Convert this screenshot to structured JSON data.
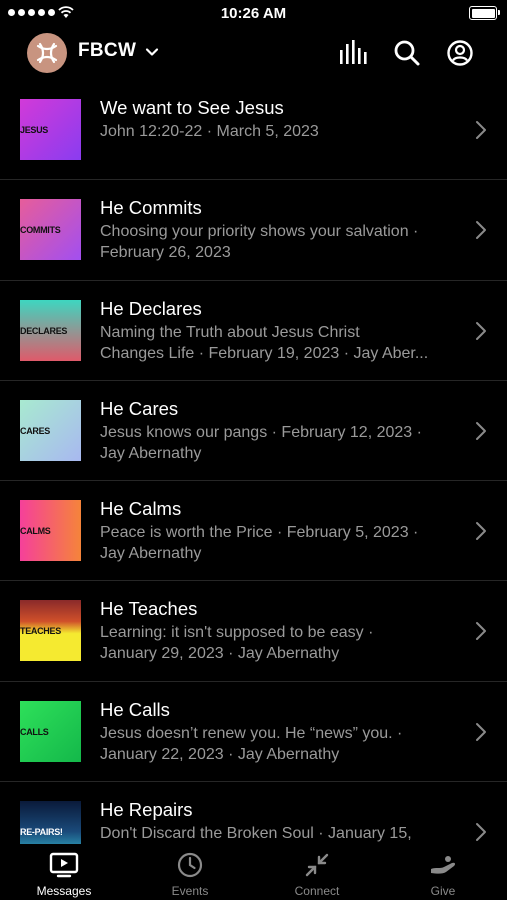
{
  "status_bar": {
    "time": "10:26 AM"
  },
  "header": {
    "church_name": "FBCW",
    "icons": [
      "church-logo",
      "chevron-down-icon",
      "audio-bars-icon",
      "search-icon",
      "account-icon"
    ]
  },
  "messages": [
    {
      "title": "We want to See Jesus",
      "subtitle": "John 12:20-22 · March 5, 2023",
      "thumb_label": "JESUS",
      "thumb_colors": [
        "#d23ad8",
        "#8a3cf0"
      ]
    },
    {
      "title": "He Commits",
      "subtitle": "Choosing your priority shows your salvation ·\nFebruary 26, 2023",
      "thumb_label": "COMMITS",
      "thumb_colors": [
        "#e75d9a",
        "#a24ff0"
      ]
    },
    {
      "title": "He Declares",
      "subtitle": "Naming the Truth about Jesus Christ\nChanges Life · February 19, 2023 · Jay Aber...",
      "thumb_label": "DECLARES",
      "thumb_colors": [
        "#3ed6c0",
        "#e05a6a"
      ]
    },
    {
      "title": "He Cares",
      "subtitle": "Jesus knows our pangs · February 12, 2023 ·\nJay Abernathy",
      "thumb_label": "CARES",
      "thumb_colors": [
        "#a8ead0",
        "#a8b8f0"
      ]
    },
    {
      "title": "He Calms",
      "subtitle": "Peace is worth the Price · February 5, 2023 ·\nJay Abernathy",
      "thumb_label": "CALMS",
      "thumb_colors": [
        "#f5409a",
        "#f5843a"
      ]
    },
    {
      "title": "He Teaches",
      "subtitle": "Learning: it isn't supposed to be easy ·\nJanuary 29, 2023 · Jay Abernathy",
      "thumb_label": "TEACHES",
      "thumb_colors": [
        "#8a2a2a",
        "#f5ea30"
      ]
    },
    {
      "title": "He Calls",
      "subtitle": "Jesus doesn’t renew you. He “news” you. ·\nJanuary 22, 2023 · Jay Abernathy",
      "thumb_label": "CALLS",
      "thumb_colors": [
        "#2ee05a",
        "#14b84a"
      ]
    },
    {
      "title": "He Repairs",
      "subtitle": "Don't Discard the Broken Soul · January 15,",
      "thumb_label": "RE-PAIRS!",
      "thumb_colors": [
        "#0a1a3a",
        "#3ad0e0"
      ]
    }
  ],
  "tabs": [
    {
      "label": "Messages",
      "active": true,
      "icon": "tv-icon"
    },
    {
      "label": "Events",
      "active": false,
      "icon": "clock-icon"
    },
    {
      "label": "Connect",
      "active": false,
      "icon": "connect-arrows-icon"
    },
    {
      "label": "Give",
      "active": false,
      "icon": "hand-give-icon"
    }
  ],
  "colors": {
    "background": "#000000",
    "text": "#ffffff",
    "subtext": "#9a9a9a",
    "divider": "#262626",
    "logo": "#c89480",
    "tab_inactive": "#8a8a8a"
  }
}
